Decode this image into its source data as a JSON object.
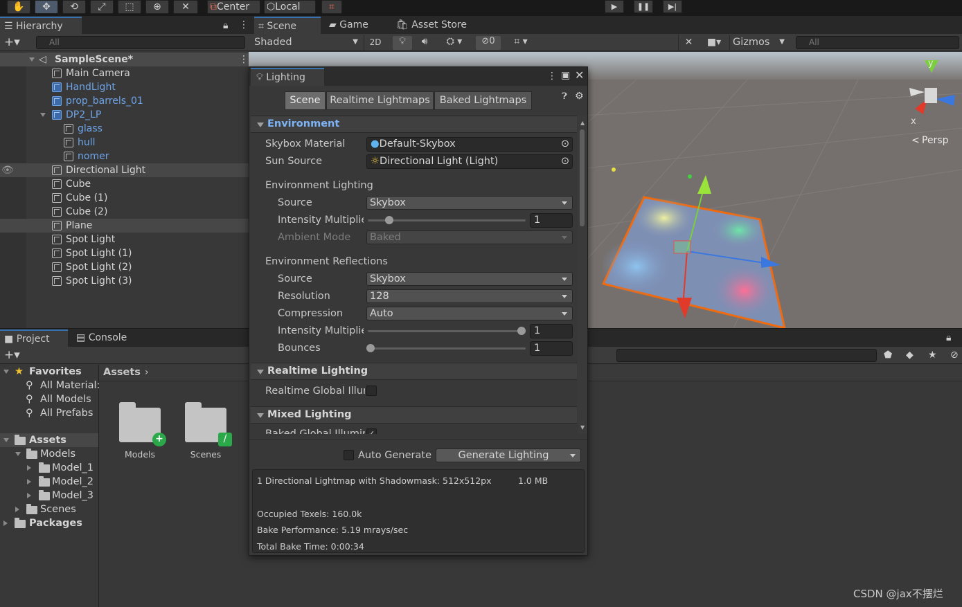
{
  "toolbar": {
    "pivot_center": "Center",
    "pivot_local": "Local"
  },
  "hierarchy": {
    "tab": "Hierarchy",
    "search_placeholder": "All",
    "scene": "SampleScene*",
    "items": [
      {
        "label": "Main Camera"
      },
      {
        "label": "HandLight"
      },
      {
        "label": "prop_barrels_01"
      },
      {
        "label": "DP2_LP"
      },
      {
        "label": "glass"
      },
      {
        "label": "hull"
      },
      {
        "label": "nomer"
      },
      {
        "label": "Directional Light"
      },
      {
        "label": "Cube"
      },
      {
        "label": "Cube (1)"
      },
      {
        "label": "Cube (2)"
      },
      {
        "label": "Plane"
      },
      {
        "label": "Spot Light"
      },
      {
        "label": "Spot Light (1)"
      },
      {
        "label": "Spot Light (2)"
      },
      {
        "label": "Spot Light (3)"
      }
    ]
  },
  "scene_view": {
    "tabs": [
      "Scene",
      "Game",
      "Asset Store"
    ],
    "shading": "Shaded",
    "two_d": "2D",
    "hidden_count": "0",
    "gizmos": "Gizmos",
    "search_placeholder": "All",
    "persp": "Persp",
    "axis_x": "x",
    "axis_y": "y"
  },
  "lighting": {
    "title": "Lighting",
    "tabs": [
      "Scene",
      "Realtime Lightmaps",
      "Baked Lightmaps"
    ],
    "environment": {
      "header": "Environment",
      "skybox_material_label": "Skybox Material",
      "skybox_material_value": "Default-Skybox",
      "sun_source_label": "Sun Source",
      "sun_source_value": "Directional Light (Light)",
      "env_lighting_label": "Environment Lighting",
      "source_label": "Source",
      "source_value": "Skybox",
      "intensity_label": "Intensity Multiplie",
      "intensity_value": "1",
      "ambient_mode_label": "Ambient Mode",
      "ambient_mode_value": "Baked",
      "env_reflections_label": "Environment Reflections",
      "refl_source_label": "Source",
      "refl_source_value": "Skybox",
      "resolution_label": "Resolution",
      "resolution_value": "128",
      "compression_label": "Compression",
      "compression_value": "Auto",
      "refl_intensity_label": "Intensity Multiplie",
      "refl_intensity_value": "1",
      "bounces_label": "Bounces",
      "bounces_value": "1"
    },
    "realtime": {
      "header": "Realtime Lighting",
      "gi_label": "Realtime Global Illur"
    },
    "mixed": {
      "header": "Mixed Lighting",
      "baked_gi_label": "Baked Global Illumir"
    },
    "auto_generate_label": "Auto Generate",
    "generate_button": "Generate Lighting",
    "info": {
      "lightmap": "1 Directional Lightmap with Shadowmask: 512x512px",
      "size": "1.0 MB",
      "texels": "Occupied Texels: 160.0k",
      "performance": "Bake Performance: 5.19 mrays/sec",
      "bake_time": "Total Bake Time: 0:00:34"
    }
  },
  "project": {
    "tabs": [
      "Project",
      "Console"
    ],
    "favorites": "Favorites",
    "fav_items": [
      "All Material:",
      "All Models",
      "All Prefabs"
    ],
    "assets": "Assets",
    "models": "Models",
    "model_items": [
      "Model_1",
      "Model_2",
      "Model_3"
    ],
    "scenes": "Scenes",
    "packages": "Packages",
    "breadcrumb": "Assets",
    "grid_items": [
      "Models",
      "Scenes"
    ]
  },
  "watermark": "CSDN @jax不摆烂",
  "colors": {
    "accent": "#3a72b0",
    "hierarchy_blue": "#6ea4e8",
    "plane_outline": "#f06a10"
  }
}
